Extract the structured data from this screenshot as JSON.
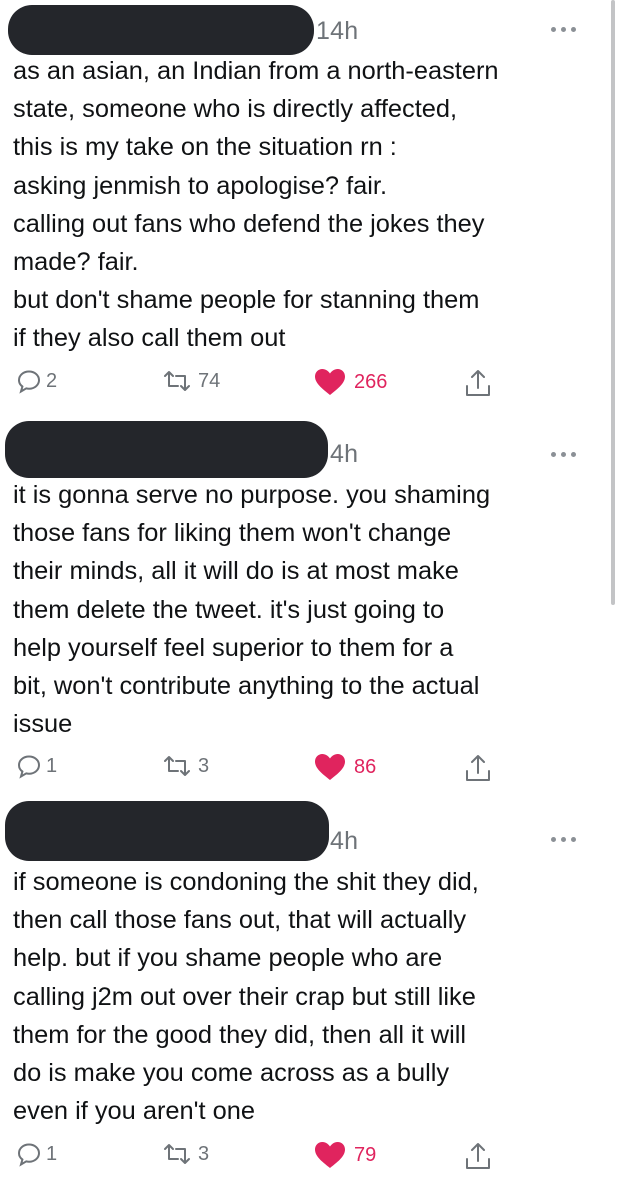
{
  "colors": {
    "like_active": "#e0245e",
    "meta_gray": "#6e7378",
    "redaction": "#24262b"
  },
  "tweets": [
    {
      "time": "14h",
      "text": "as an asian, an Indian from a north-eastern\nstate, someone who is directly affected,\nthis is my take on the situation rn :\nasking jenmish to apologise? fair.\ncalling out fans who defend the jokes they\nmade? fair.\nbut don't shame people for stanning them\nif they also call them out",
      "replies": "2",
      "retweets": "74",
      "likes": "266"
    },
    {
      "time": "4h",
      "text": "it is gonna serve no purpose. you shaming\nthose fans for liking them won't change\ntheir minds, all it will do is at most make\nthem delete the tweet. it's just going to\nhelp yourself feel superior to them for a\nbit, won't contribute anything to the actual\nissue",
      "replies": "1",
      "retweets": "3",
      "likes": "86"
    },
    {
      "time": "4h",
      "text": "if someone is condoning the shit they did,\nthen call those fans out, that will actually\nhelp. but if you shame people who are\ncalling j2m out over their crap but still like\nthem for the good they did, then all it will\ndo is make you come across as a bully\neven if you aren't one",
      "replies": "1",
      "retweets": "3",
      "likes": "79"
    }
  ]
}
